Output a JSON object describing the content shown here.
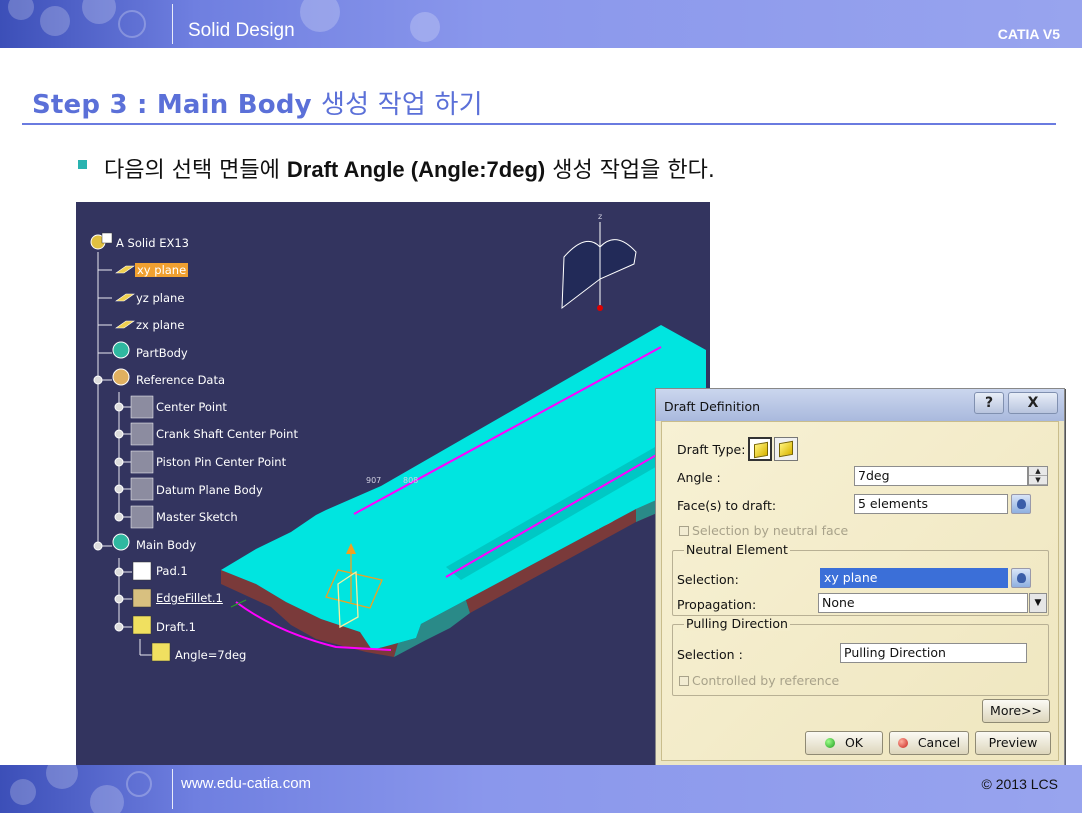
{
  "header": {
    "section": "Solid Design",
    "brand": "CATIA V5"
  },
  "heading": {
    "step": "Step 3 : Main Body",
    "rest": "생성 작업 하기"
  },
  "bullet": {
    "pre": "다음의 선택 면들에",
    "bold": "Draft Angle (Angle:7deg)",
    "post": "생성 작업을 한다."
  },
  "tree": {
    "root": "A Solid EX13",
    "items": [
      "xy plane",
      "yz plane",
      "zx plane",
      "PartBody",
      "Reference Data",
      "Center Point",
      "Crank Shaft Center Point",
      "Piston Pin Center Point",
      "Datum Plane Body",
      "Master Sketch",
      "Main Body",
      "Pad.1",
      "EdgeFillet.1",
      "Draft.1",
      "Angle=7deg"
    ]
  },
  "viewport": {
    "axis_x": "907",
    "axis_y": "808",
    "compass_z": "z"
  },
  "dialog": {
    "title": "Draft Definition",
    "help": "?",
    "close": "X",
    "draft_type_label": "Draft Type:",
    "angle_label": "Angle :",
    "angle_value": "7deg",
    "faces_label": "Face(s) to draft:",
    "faces_value": "5 elements",
    "neutral_face_check": "Selection by neutral face",
    "neutral_group": "Neutral Element",
    "neutral_selection_label": "Selection:",
    "neutral_selection_value": "xy plane",
    "propagation_label": "Propagation:",
    "propagation_value": "None",
    "pulling_group": "Pulling Direction",
    "pulling_selection_label": "Selection :",
    "pulling_selection_value": "Pulling Direction",
    "controlled_check": "Controlled by reference",
    "more_button": "More>>",
    "ok_button": "OK",
    "cancel_button": "Cancel",
    "preview_button": "Preview"
  },
  "footer": {
    "url": "www.edu-catia.com",
    "copyright": "© 2013 LCS"
  },
  "colors": {
    "banner": "#6f7fe0",
    "title": "#5b70d8",
    "part_top": "#00e5e0",
    "part_side": "#7a3a3a",
    "edge": "#ff00ff"
  }
}
